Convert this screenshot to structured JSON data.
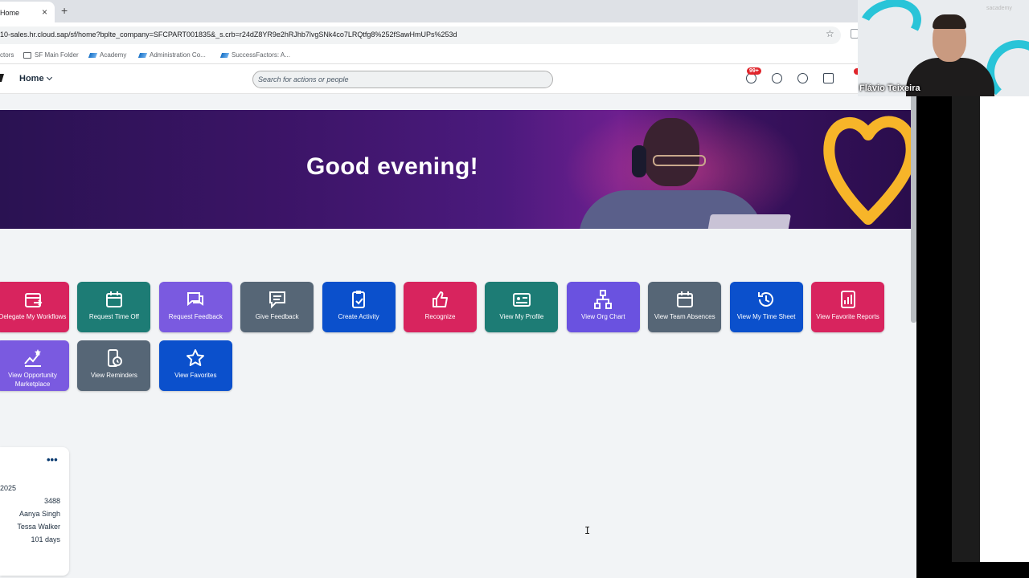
{
  "browser": {
    "tab_title": "Home",
    "tab_close": "×",
    "new_tab": "+",
    "url": "10-sales.hr.cloud.sap/sf/home?bplte_company=SFCPART001835&_s.crb=r24dZ8YR9e2hRJhb7lvgSNk4co7LRQtfg8%252fSawHmUPs%253d",
    "bookmarks": [
      "ctors",
      "SF Main Folder",
      "Academy",
      "Administration Co...",
      "SuccessFactors: A..."
    ]
  },
  "shell": {
    "home_label": "Home",
    "search_placeholder": "Search for actions or people",
    "notification_badge": "99+"
  },
  "banner": {
    "greeting": "Good evening!"
  },
  "quick_actions": [
    {
      "label": "Delegate My Workflows",
      "color": "#d8245e",
      "icon": "delegate-workflow-icon"
    },
    {
      "label": "Request Time Off",
      "color": "#1d7c75",
      "icon": "calendar-icon"
    },
    {
      "label": "Request Feedback",
      "color": "#7a5ae0",
      "icon": "chat-bubbles-icon"
    },
    {
      "label": "Give Feedback",
      "color": "#566676",
      "icon": "chat-bubble-icon"
    },
    {
      "label": "Create Activity",
      "color": "#0b50cc",
      "icon": "clipboard-check-icon"
    },
    {
      "label": "Recognize",
      "color": "#d8245e",
      "icon": "thumbs-up-icon"
    },
    {
      "label": "View My Profile",
      "color": "#1d7c75",
      "icon": "id-card-icon"
    },
    {
      "label": "View Org Chart",
      "color": "#6a52e0",
      "icon": "org-chart-icon"
    },
    {
      "label": "View Team Absences",
      "color": "#566676",
      "icon": "calendar-icon"
    },
    {
      "label": "View My Time Sheet",
      "color": "#0b50cc",
      "icon": "history-icon"
    },
    {
      "label": "View Favorite Reports",
      "color": "#d8245e",
      "icon": "reports-icon"
    },
    {
      "label": "View Opportunity Marketplace",
      "color": "#7a5ae0",
      "icon": "opportunity-icon"
    },
    {
      "label": "View Reminders",
      "color": "#566676",
      "icon": "reminder-icon"
    },
    {
      "label": "View Favorites",
      "color": "#0b50cc",
      "icon": "star-icon"
    }
  ],
  "card": {
    "more": "•••",
    "year": "2025",
    "rows": [
      "3488",
      "Aanya Singh",
      "Tessa Walker",
      "101 days"
    ]
  },
  "webcam": {
    "presenter_name": "Flávio Teixeira",
    "watermark": "sacademy"
  }
}
